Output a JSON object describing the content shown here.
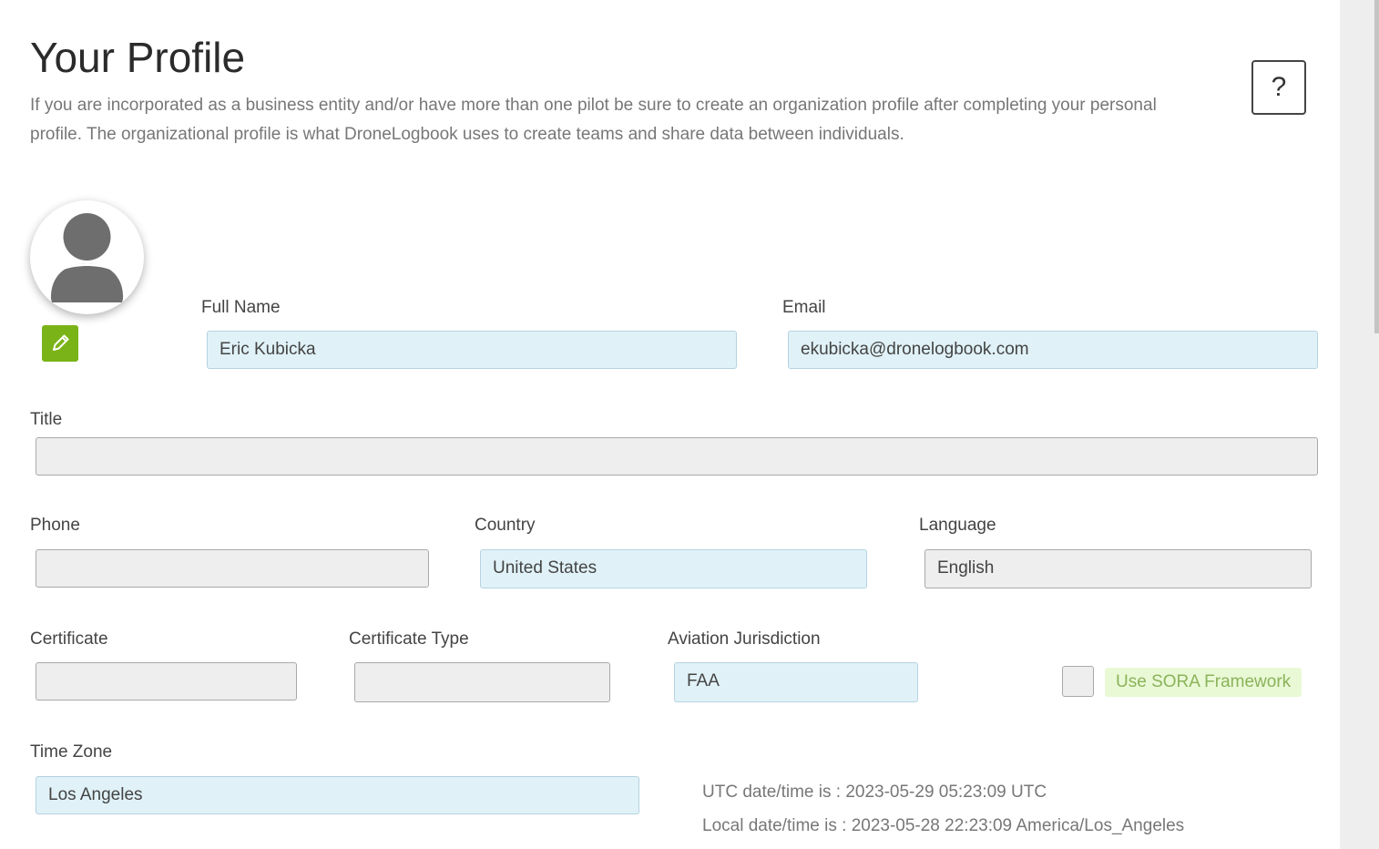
{
  "page": {
    "title": "Your Profile",
    "description": "If you are incorporated as a business entity and/or have more than one pilot be sure to create an organization profile after completing your personal profile. The organizational profile is what DroneLogbook uses to create teams and share data between individuals.",
    "help_label": "?"
  },
  "avatar": {
    "icon": "user-silhouette-icon",
    "edit_icon": "pencil-icon"
  },
  "colors": {
    "accent_green": "#7ab317",
    "filled_field_bg": "#e0f2f8",
    "empty_field_bg": "#eeeeee",
    "sora_label_bg": "#e9f9d6"
  },
  "fields": {
    "full_name": {
      "label": "Full Name",
      "value": "Eric Kubicka"
    },
    "email": {
      "label": "Email",
      "value": "ekubicka@dronelogbook.com"
    },
    "title": {
      "label": "Title",
      "value": ""
    },
    "phone": {
      "label": "Phone",
      "value": ""
    },
    "country": {
      "label": "Country",
      "value": "United States"
    },
    "language": {
      "label": "Language",
      "value": "English"
    },
    "certificate": {
      "label": "Certificate",
      "value": ""
    },
    "certificate_type": {
      "label": "Certificate Type",
      "value": ""
    },
    "aviation_jurisdiction": {
      "label": "Aviation Jurisdiction",
      "value": "FAA"
    },
    "time_zone": {
      "label": "Time Zone",
      "value": "Los Angeles"
    }
  },
  "sora": {
    "label": "Use SORA Framework",
    "checked": false
  },
  "datetime": {
    "utc": "UTC date/time is : 2023-05-29 05:23:09 UTC",
    "local": "Local date/time is : 2023-05-28 22:23:09 America/Los_Angeles"
  }
}
